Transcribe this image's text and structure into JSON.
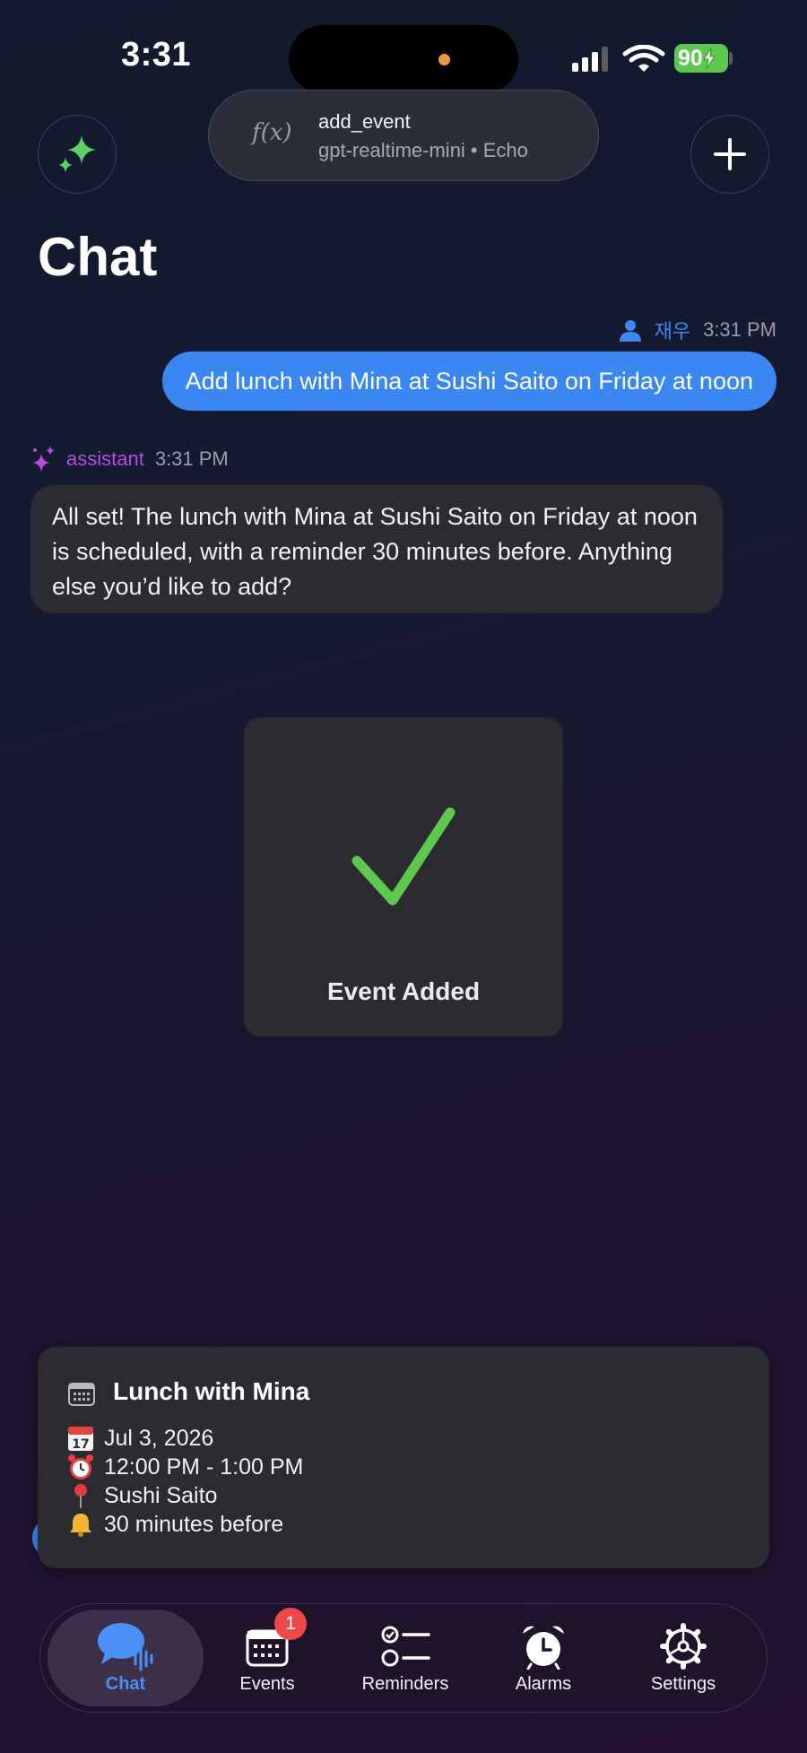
{
  "status_bar": {
    "time": "3:31",
    "battery": "90"
  },
  "header": {
    "function_icon": "f(x)",
    "function_name": "add_event",
    "model_info": "gpt-realtime-mini • Echo",
    "page_title": "Chat"
  },
  "messages": {
    "user": {
      "name": "재우",
      "time": "3:31 PM",
      "text": "Add lunch with Mina at Sushi Saito on Friday at noon"
    },
    "assistant": {
      "name": "assistant",
      "time": "3:31 PM",
      "text": "All set! The lunch with Mina at Sushi Saito on Friday at noon is scheduled, with a reminder 30 minutes before. Anything else you’d like to add?"
    }
  },
  "toast": {
    "label": "Event Added",
    "icon": "checkmark-icon"
  },
  "event_card": {
    "title": "Lunch with Mina",
    "date": "Jul 3, 2026",
    "time": "12:00 PM - 1:00 PM",
    "location": "Sushi Saito",
    "reminder": "30 minutes before"
  },
  "tabs": [
    {
      "label": "Chat",
      "icon": "chat-voice-icon",
      "active": true
    },
    {
      "label": "Events",
      "icon": "calendar-icon",
      "badge": "1"
    },
    {
      "label": "Reminders",
      "icon": "checklist-icon"
    },
    {
      "label": "Alarms",
      "icon": "alarm-clock-icon"
    },
    {
      "label": "Settings",
      "icon": "gear-icon"
    }
  ],
  "colors": {
    "accent_blue": "#3a86f2",
    "assistant_purple": "#b44ce0",
    "success_green": "#5ec84e",
    "badge_red": "#f04848"
  }
}
